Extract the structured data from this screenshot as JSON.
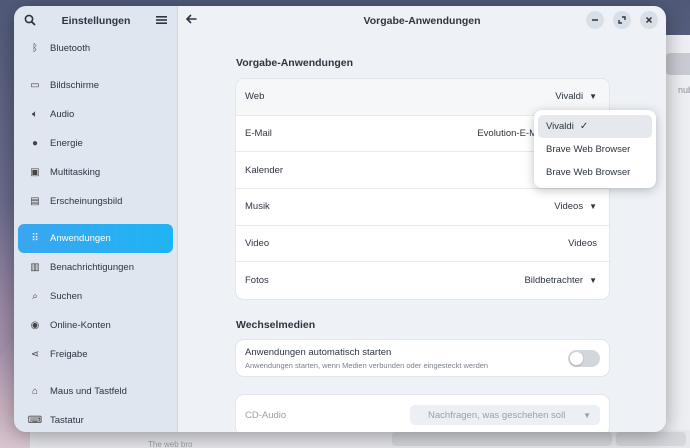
{
  "sidebar": {
    "title": "Einstellungen",
    "items": [
      {
        "label": "Bluetooth",
        "icon": "bluetooth-icon"
      },
      {
        "label": "Bildschirme",
        "icon": "display-icon"
      },
      {
        "label": "Audio",
        "icon": "speaker-icon"
      },
      {
        "label": "Energie",
        "icon": "power-icon"
      },
      {
        "label": "Multitasking",
        "icon": "multitasking-icon"
      },
      {
        "label": "Erscheinungsbild",
        "icon": "appearance-icon"
      },
      {
        "label": "Anwendungen",
        "icon": "apps-grid-icon",
        "active": true
      },
      {
        "label": "Benachrichtigungen",
        "icon": "bell-icon"
      },
      {
        "label": "Suchen",
        "icon": "search-icon"
      },
      {
        "label": "Online-Konten",
        "icon": "online-accounts-icon"
      },
      {
        "label": "Freigabe",
        "icon": "share-icon"
      },
      {
        "label": "Maus und Tastfeld",
        "icon": "mouse-icon"
      },
      {
        "label": "Tastatur",
        "icon": "keyboard-icon"
      }
    ]
  },
  "header": {
    "title": "Vorgabe-Anwendungen"
  },
  "defaults": {
    "section_title": "Vorgabe-Anwendungen",
    "rows": [
      {
        "label": "Web",
        "value": "Vivaldi"
      },
      {
        "label": "E-Mail",
        "value": "Evolution-E-M"
      },
      {
        "label": "Kalender",
        "value": ""
      },
      {
        "label": "Musik",
        "value": "Videos"
      },
      {
        "label": "Video",
        "value": "Videos"
      },
      {
        "label": "Fotos",
        "value": "Bildbetrachter"
      }
    ]
  },
  "popover": {
    "options": [
      "Vivaldi",
      "Brave Web Browser",
      "Brave Web Browser"
    ]
  },
  "media": {
    "section_title": "Wechselmedien",
    "autostart_label": "Anwendungen automatisch starten",
    "autostart_desc": "Anwendungen starten, wenn Medien verbunden oder eingesteckt werden",
    "cd_label": "CD-Audio",
    "cd_value": "Nachfragen, was geschehen soll"
  },
  "background": {
    "snippet": "nub",
    "bottom_text": "The web bro"
  },
  "colors": {
    "accent": "#1fb4f5",
    "sidebar_bg": "#dfe6ef",
    "content_bg": "#eef2f7"
  }
}
